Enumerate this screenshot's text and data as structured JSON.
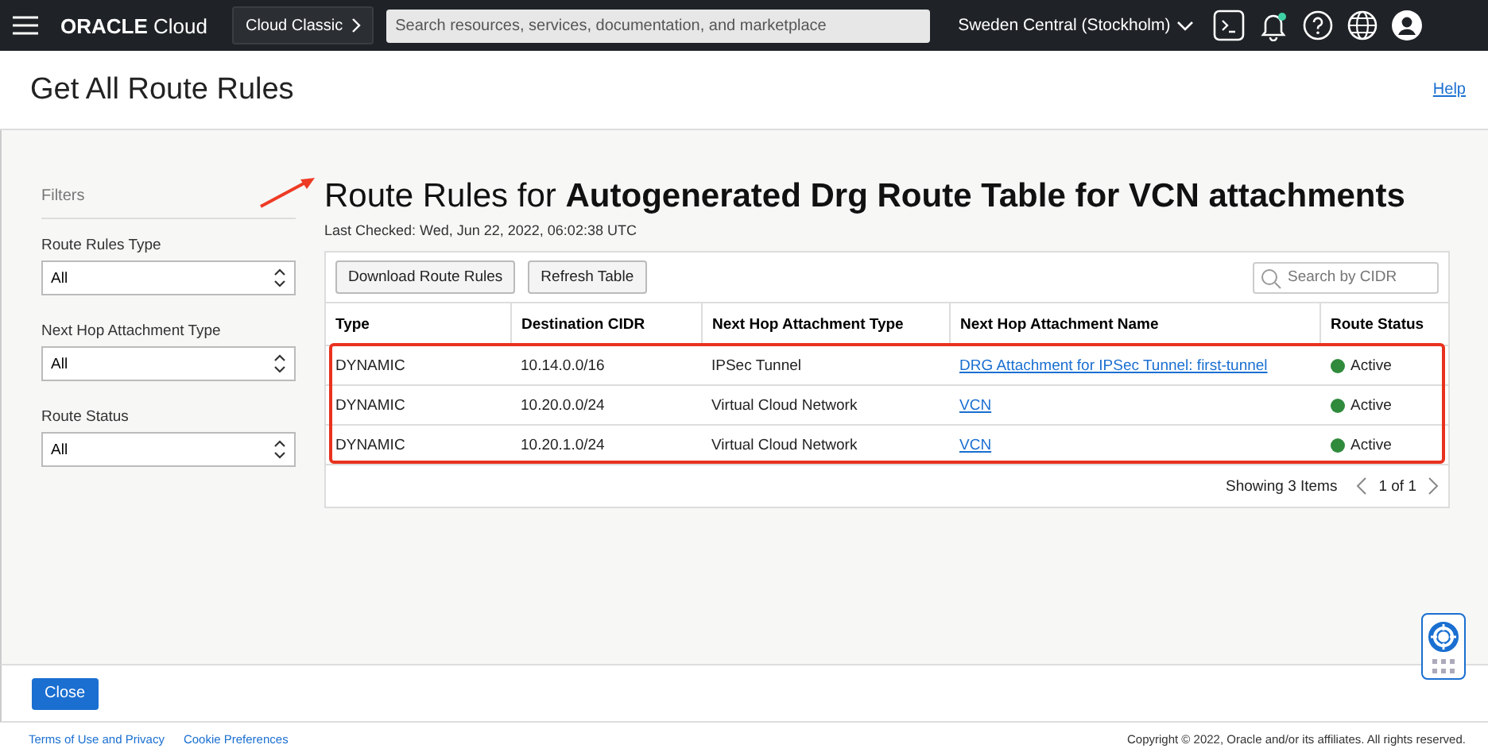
{
  "top_bar": {
    "brand": "ORACLE",
    "product": "Cloud",
    "classic_button": "Cloud Classic",
    "search": {
      "placeholder": "Search resources, services, documentation, and marketplace"
    },
    "region": "Sweden Central (Stockholm)",
    "notification_dot": true
  },
  "panel": {
    "title": "Get All Route Rules",
    "help_link": "Help"
  },
  "filters": {
    "heading": "Filters",
    "fields": [
      {
        "label": "Route Rules Type",
        "value": "All"
      },
      {
        "label": "Next Hop Attachment Type",
        "value": "All"
      },
      {
        "label": "Route Status",
        "value": "All"
      }
    ]
  },
  "content": {
    "title_prefix": "Route Rules for ",
    "title_name": "Autogenerated Drg Route Table for VCN attachments",
    "last_checked": "Last Checked: Wed, Jun 22, 2022, 06:02:38 UTC"
  },
  "table": {
    "buttons": [
      "Download Route Rules",
      "Refresh Table"
    ],
    "search": {
      "placeholder": "Search by CIDR"
    },
    "columns": [
      "Type",
      "Destination CIDR",
      "Next Hop Attachment Type",
      "Next Hop Attachment Name",
      "Route Status"
    ],
    "rows": [
      {
        "type": "DYNAMIC",
        "cidr": "10.14.0.0/16",
        "hop_type": "IPSec Tunnel",
        "hop_name": "DRG Attachment for IPSec Tunnel: first-tunnel",
        "status": "Active"
      },
      {
        "type": "DYNAMIC",
        "cidr": "10.20.0.0/24",
        "hop_type": "Virtual Cloud Network",
        "hop_name": "VCN",
        "status": "Active"
      },
      {
        "type": "DYNAMIC",
        "cidr": "10.20.1.0/24",
        "hop_type": "Virtual Cloud Network",
        "hop_name": "VCN",
        "status": "Active"
      }
    ],
    "summary": "Showing 3 Items",
    "page": "1 of 1"
  },
  "footer_button": "Close",
  "page_footer": {
    "links": [
      "Terms of Use and Privacy",
      "Cookie Preferences"
    ],
    "copyright": "Copyright © 2022, Oracle and/or its affiliates. All rights reserved."
  }
}
